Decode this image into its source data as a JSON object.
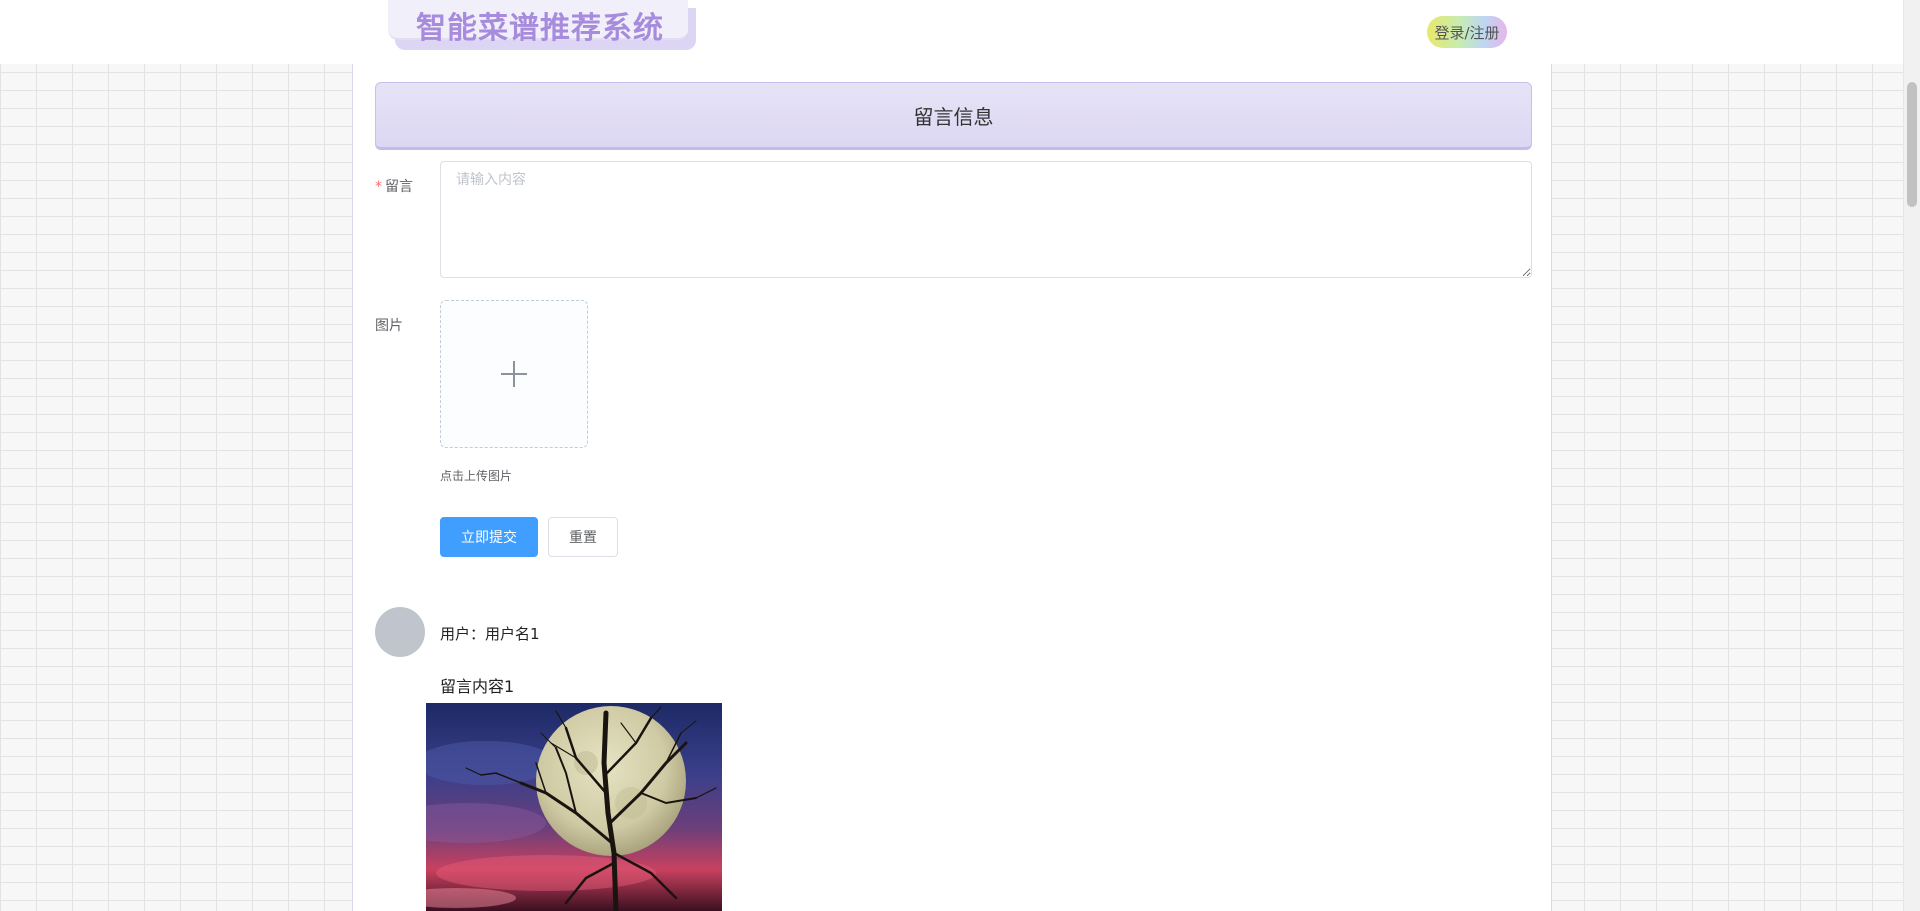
{
  "header": {
    "site_title": "智能菜谱推荐系统",
    "login_label": "登录/注册"
  },
  "section": {
    "title": "留言信息"
  },
  "form": {
    "message_label": "留言",
    "required_mark": "*",
    "message_placeholder": "请输入内容",
    "message_value": "",
    "image_label": "图片",
    "upload_tip": "点击上传图片",
    "submit_label": "立即提交",
    "reset_label": "重置"
  },
  "comments": [
    {
      "user_prefix": "用户：",
      "user_name": "用户名1",
      "content": "留言内容1",
      "image_subject": "full-moon-bare-tree-night-sky"
    }
  ],
  "colors": {
    "brand_title": "#a78bdc",
    "banner_bg": "#dcd7f3",
    "primary_button": "#409eff",
    "required_mark": "#f56c6c",
    "avatar_placeholder": "#c0c4cc"
  }
}
